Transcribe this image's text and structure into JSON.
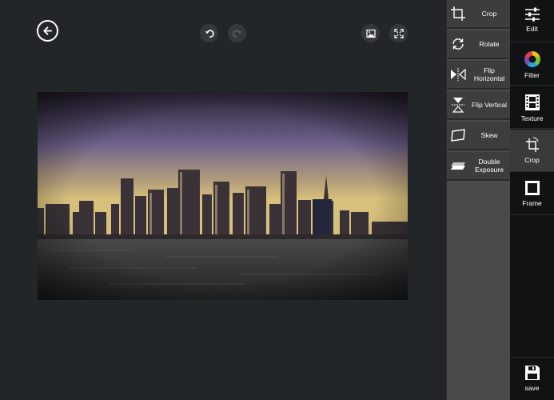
{
  "topbar": {
    "back": "back-icon",
    "undo": "undo-icon",
    "redo": "redo-icon",
    "compare": "compare-icon",
    "fullscreen": "fullscreen-icon"
  },
  "photo": {
    "subject": "city skyline at dusk over water"
  },
  "crop_menu": {
    "items": [
      {
        "label": "Crop",
        "icon": "crop-icon"
      },
      {
        "label": "Rotate",
        "icon": "rotate-icon"
      },
      {
        "label": "Flip Horizontal",
        "icon": "flip-horizontal-icon"
      },
      {
        "label": "Flip Vertical",
        "icon": "flip-vertical-icon"
      },
      {
        "label": "Skew",
        "icon": "skew-icon"
      },
      {
        "label": "Double Exposure",
        "icon": "double-exposure-icon"
      }
    ]
  },
  "toolbar": {
    "items": [
      {
        "label": "Edit",
        "icon": "sliders-icon"
      },
      {
        "label": "Filter",
        "icon": "color-wheel-icon"
      },
      {
        "label": "Texture",
        "icon": "film-icon"
      },
      {
        "label": "Crop",
        "icon": "crop-icon"
      },
      {
        "label": "Frame",
        "icon": "frame-icon"
      }
    ],
    "active": "Crop",
    "save_label": "save"
  },
  "colors": {
    "accent_active": "#3a3a3a",
    "background": "#222629"
  }
}
